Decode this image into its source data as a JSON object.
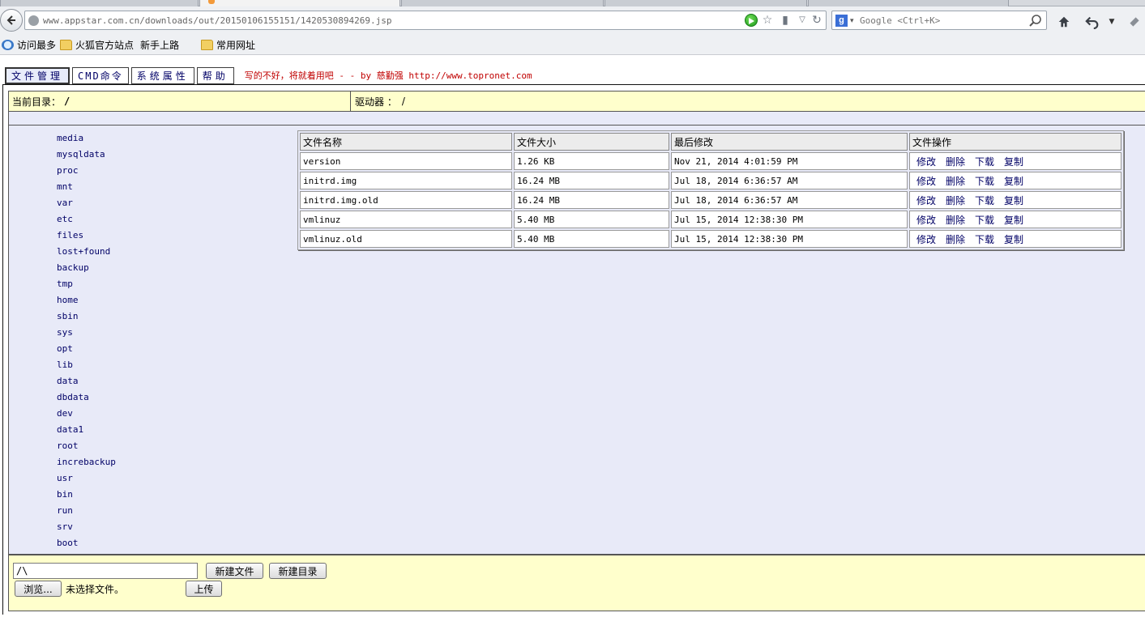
{
  "browser": {
    "url": "www.appstar.com.cn/downloads/out/20150106155151/1420530894269.jsp",
    "search_placeholder": "Google <Ctrl+K>",
    "search_engine_letter": "g",
    "bookmarks": [
      "访问最多",
      "火狐官方站点",
      "新手上路",
      "常用网址"
    ]
  },
  "menu": {
    "items": [
      "文件管理",
      "CMD命令",
      "系统属性",
      "帮助"
    ],
    "tagline": "写的不好，将就着用吧 - - by 慈勤强 http://www.topronet.com"
  },
  "pathbar": {
    "current_dir_label": "当前目录：",
    "current_dir_value": "/",
    "drive_label": "驱动器 ：",
    "drive_value": "/"
  },
  "tree": {
    "items": [
      "media",
      "mysqldata",
      "proc",
      "mnt",
      "var",
      "etc",
      "files",
      "lost+found",
      "backup",
      "tmp",
      "home",
      "sbin",
      "sys",
      "opt",
      "lib",
      "data",
      "dbdata",
      "dev",
      "data1",
      "root",
      "increbackup",
      "usr",
      "bin",
      "run",
      "srv",
      "boot"
    ]
  },
  "files": {
    "headers": [
      "文件名称",
      "文件大小",
      "最后修改",
      "文件操作"
    ],
    "ops": [
      "修改",
      "删除",
      "下载",
      "复制"
    ],
    "rows": [
      [
        "version",
        "1.26 KB",
        "Nov 21, 2014 4:01:59 PM"
      ],
      [
        "initrd.img",
        "16.24 MB",
        "Jul 18, 2014 6:36:57 AM"
      ],
      [
        "initrd.img.old",
        "16.24 MB",
        "Jul 18, 2014 6:36:57 AM"
      ],
      [
        "vmlinuz",
        "5.40 MB",
        "Jul 15, 2014 12:38:30 PM"
      ],
      [
        "vmlinuz.old",
        "5.40 MB",
        "Jul 15, 2014 12:38:30 PM"
      ]
    ]
  },
  "bottom": {
    "path_value": "/\\",
    "new_file_label": "新建文件",
    "new_dir_label": "新建目录",
    "browse_label": "浏览...",
    "no_file_text": "未选择文件。",
    "upload_label": "上传"
  },
  "colors": {
    "link": "#000066",
    "tagline": "#c00000",
    "panel_bg": "#e8eaf8",
    "path_bg": "#ffffcc"
  }
}
